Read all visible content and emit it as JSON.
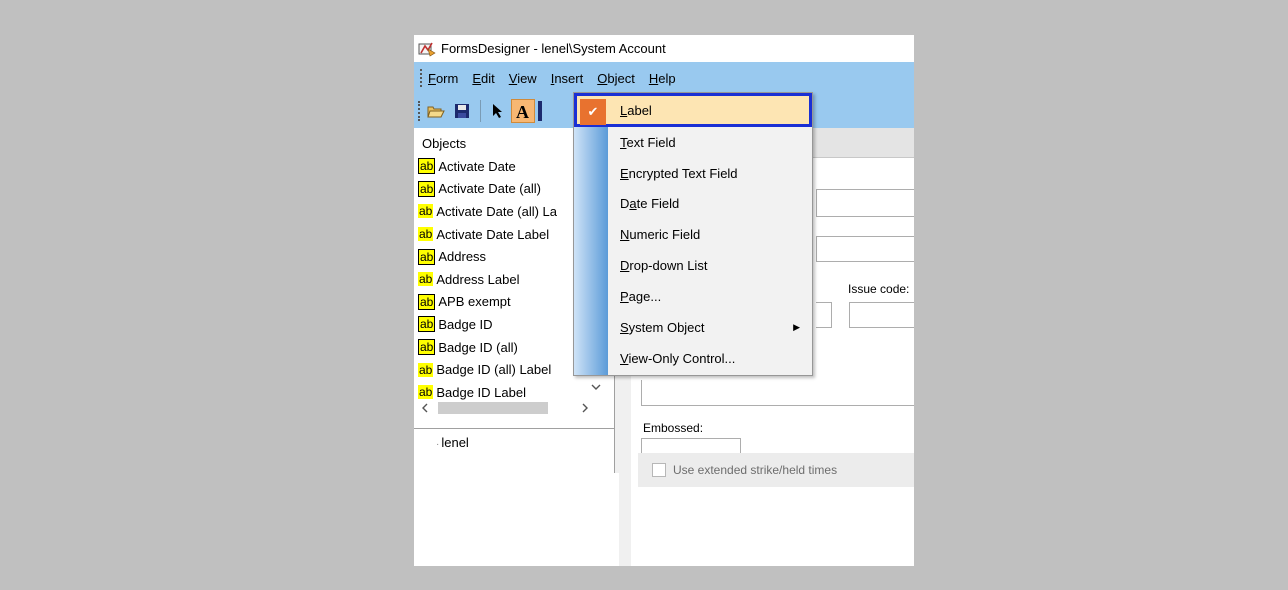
{
  "window": {
    "title": "FormsDesigner - lenel\\System Account"
  },
  "menubar": {
    "items": [
      "Form",
      "Edit",
      "View",
      "Insert",
      "Object",
      "Help"
    ],
    "underlines": [
      "F",
      "E",
      "V",
      "I",
      "O",
      "H"
    ]
  },
  "left_pane": {
    "header": "Objects",
    "items": [
      {
        "label": "Activate Date",
        "boxed": true
      },
      {
        "label": "Activate Date (all)",
        "boxed": true
      },
      {
        "label": "Activate Date (all) La",
        "boxed": false
      },
      {
        "label": "Activate Date Label",
        "boxed": false
      },
      {
        "label": "Address",
        "boxed": true
      },
      {
        "label": "Address Label",
        "boxed": false
      },
      {
        "label": "APB exempt",
        "boxed": true
      },
      {
        "label": "Badge ID",
        "boxed": true
      },
      {
        "label": "Badge ID (all)",
        "boxed": true
      },
      {
        "label": "Badge ID (all) Label",
        "boxed": false
      },
      {
        "label": "Badge ID Label",
        "boxed": false
      }
    ],
    "tree_item": "lenel"
  },
  "right_pane": {
    "issue_code_label": "Issue code:",
    "embossed_label": "Embossed:",
    "checkbox_label": "Use extended strike/held times"
  },
  "dropdown": {
    "items": [
      {
        "label": "Label",
        "mnemonic": "L",
        "checked": true,
        "submenu": false
      },
      {
        "label": "Text Field",
        "mnemonic": "T",
        "checked": false,
        "submenu": false
      },
      {
        "label": "Encrypted Text Field",
        "mnemonic": "E",
        "checked": false,
        "submenu": false
      },
      {
        "label": "Date Field",
        "mnemonic": "a",
        "checked": false,
        "submenu": false
      },
      {
        "label": "Numeric Field",
        "mnemonic": "N",
        "checked": false,
        "submenu": false
      },
      {
        "label": "Drop-down List",
        "mnemonic": "D",
        "checked": false,
        "submenu": false
      },
      {
        "label": "Page...",
        "mnemonic": "P",
        "checked": false,
        "submenu": false
      },
      {
        "label": "System Object",
        "mnemonic": "S",
        "checked": false,
        "submenu": true
      },
      {
        "label": "View-Only Control...",
        "mnemonic": "V",
        "checked": false,
        "submenu": false
      }
    ]
  },
  "colors": {
    "accent_blue": "#1a2fd4",
    "selected_bg": "#fde5b3",
    "check_orange": "#e8722f",
    "menubar": "#99c9ef"
  }
}
